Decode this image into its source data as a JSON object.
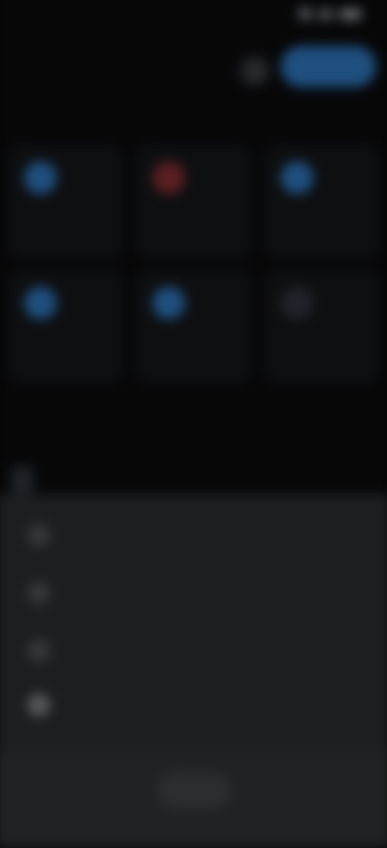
{
  "status_bar": {
    "time": "",
    "battery": ""
  },
  "header": {
    "title": "",
    "primary_button": ""
  },
  "sections": [
    {
      "title": "",
      "action": ""
    },
    {
      "title": "",
      "action": ""
    }
  ],
  "devices": [
    {
      "name": "",
      "status": "",
      "icon": "circle-icon",
      "color": "#1f4f7f"
    },
    {
      "name": "",
      "status": "",
      "icon": "circle-icon",
      "color": "#5a1f22"
    },
    {
      "name": "",
      "status": "",
      "icon": "circle-icon",
      "color": "#1f4f7f"
    },
    {
      "name": "",
      "status": "",
      "icon": "circle-icon",
      "color": "#1f4f7f"
    },
    {
      "name": "",
      "status": "",
      "icon": "circle-icon",
      "color": "#1f4f7f"
    },
    {
      "name": "",
      "status": "",
      "icon": "circle-icon",
      "color": "#202329"
    }
  ],
  "filter_chip": "",
  "sheet_items": [
    {
      "label": "",
      "icon": "circle-icon"
    },
    {
      "label": "",
      "icon": "circle-icon"
    },
    {
      "label": "",
      "icon": "circle-icon"
    },
    {
      "label": "",
      "icon": "circle-icon"
    }
  ],
  "close_button": "",
  "colors": {
    "background": "#070708",
    "accent": "#1f4f7f",
    "alert": "#5a1f22",
    "sheet": "#1d1e20"
  }
}
